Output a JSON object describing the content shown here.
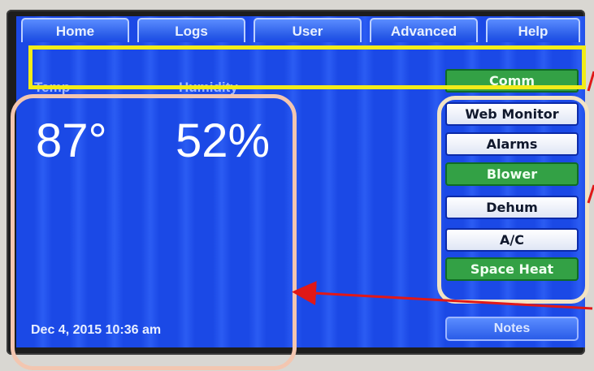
{
  "tabs": [
    "Home",
    "Logs",
    "User",
    "Advanced",
    "Help"
  ],
  "comm_button": "Comm",
  "metrics": {
    "temp_label": "Temp",
    "humidity_label": "Humidity",
    "temperature": "87°",
    "humidity": "52%"
  },
  "side_buttons": [
    {
      "label": "Web Monitor",
      "style": "white"
    },
    {
      "label": "Alarms",
      "style": "white"
    },
    {
      "label": "Blower",
      "style": "green"
    },
    {
      "label": "Dehum",
      "style": "white"
    },
    {
      "label": "A/C",
      "style": "white"
    },
    {
      "label": "Space Heat",
      "style": "green"
    }
  ],
  "datetime": "Dec 4, 2015  10:36 am",
  "notes_button": "Notes",
  "colors": {
    "screen_blue": "#1b49e6",
    "green": "#33a145",
    "yellow_highlight": "#f2ec19",
    "pink_highlight": "#f3c6b0",
    "arrow_red": "#e01818"
  }
}
